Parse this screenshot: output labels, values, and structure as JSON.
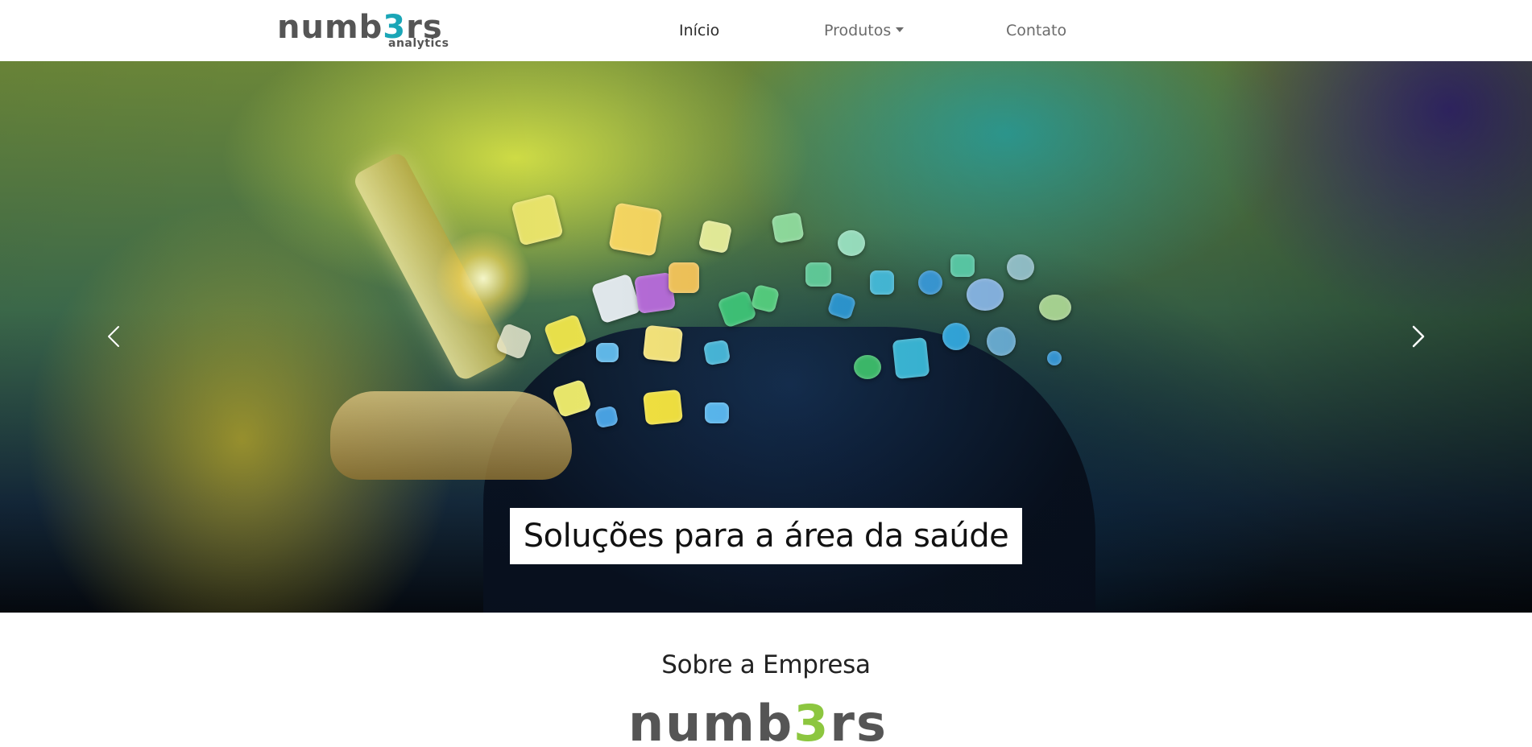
{
  "brand": {
    "logo_main_pre": "numb",
    "logo_main_accent": "3",
    "logo_main_post": "rs",
    "logo_sub": "analytics"
  },
  "nav": {
    "items": [
      {
        "label": "Início",
        "active": true
      },
      {
        "label": "Produtos",
        "dropdown": true
      },
      {
        "label": "Contato"
      }
    ]
  },
  "hero": {
    "caption": "Soluções para a área da saúde",
    "prev_icon": "chevron-left-icon",
    "next_icon": "chevron-right-icon"
  },
  "about": {
    "title": "Sobre a Empresa",
    "logo_pre": "numb",
    "logo_accent": "3",
    "logo_post": "rs"
  },
  "colors": {
    "nav_text": "#6b6b6b",
    "nav_active": "#2b2b2b",
    "logo_gray": "#555555",
    "logo_teal": "#1aa6b7",
    "logo_green": "#8cc63f",
    "caption_bg": "#ffffff"
  }
}
